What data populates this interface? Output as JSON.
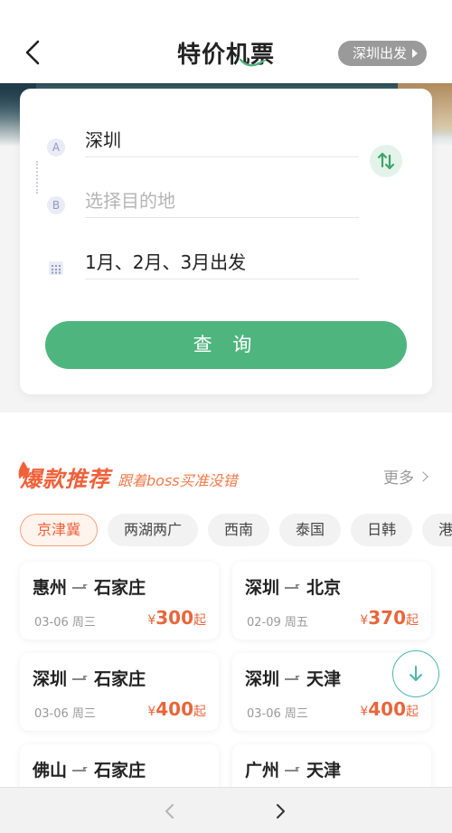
{
  "header": {
    "title": "特价机票",
    "origin_pill": "深圳出发"
  },
  "search": {
    "from_marker": "A",
    "to_marker": "B",
    "from_city": "深圳",
    "to_placeholder": "选择目的地",
    "date_text": "1月、2月、3月出发",
    "query_button": "查 询"
  },
  "recommend": {
    "title": "爆款推荐",
    "subtitle": "跟着boss买准没错",
    "more_label": "更多",
    "tabs": [
      "京津冀",
      "两湖两广",
      "西南",
      "泰国",
      "日韩",
      "港"
    ],
    "active_tab": "京津冀",
    "price_suffix": "起",
    "currency": "¥",
    "cards": [
      {
        "from": "惠州",
        "to": "石家庄",
        "date": "03-06 周三",
        "price": "300"
      },
      {
        "from": "深圳",
        "to": "北京",
        "date": "02-09 周五",
        "price": "370"
      },
      {
        "from": "深圳",
        "to": "石家庄",
        "date": "03-06 周三",
        "price": "400"
      },
      {
        "from": "深圳",
        "to": "天津",
        "date": "03-06 周三",
        "price": "400"
      },
      {
        "from": "佛山",
        "to": "石家庄",
        "date": "",
        "price": ""
      },
      {
        "from": "广州",
        "to": "天津",
        "date": "",
        "price": ""
      }
    ]
  },
  "colors": {
    "accent_green": "#4fb57e",
    "accent_orange": "#f0613a",
    "price_orange": "#e8663b"
  },
  "icons": {
    "back": "chevron-left-icon",
    "swap": "swap-vertical-icon",
    "calendar": "calendar-icon",
    "scroll_down": "arrow-down-icon",
    "nav_back": "chevron-left-icon",
    "nav_forward": "chevron-right-icon"
  }
}
